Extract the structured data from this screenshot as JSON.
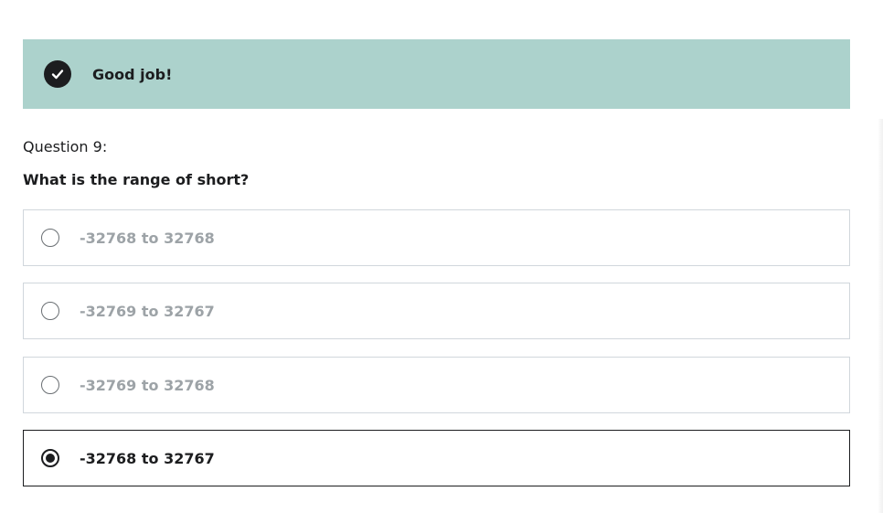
{
  "banner": {
    "icon": "check-circle-icon",
    "message": "Good job!",
    "color": "#acd2cc"
  },
  "question": {
    "number_label": "Question 9:",
    "text": "What is the range of short?"
  },
  "options": [
    {
      "label": "-32768 to 32768",
      "selected": false
    },
    {
      "label": "-32769 to 32767",
      "selected": false
    },
    {
      "label": "-32769 to 32768",
      "selected": false
    },
    {
      "label": "-32768 to 32767",
      "selected": true
    }
  ]
}
